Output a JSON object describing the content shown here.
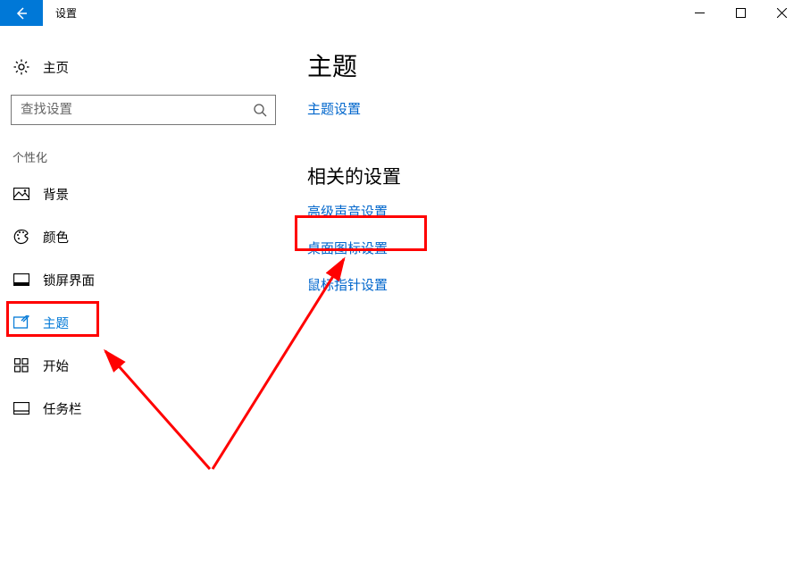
{
  "window": {
    "title": "设置"
  },
  "sidebar": {
    "home": "主页",
    "search_placeholder": "查找设置",
    "section": "个性化",
    "items": [
      {
        "label": "背景"
      },
      {
        "label": "颜色"
      },
      {
        "label": "锁屏界面"
      },
      {
        "label": "主题"
      },
      {
        "label": "开始"
      },
      {
        "label": "任务栏"
      }
    ]
  },
  "content": {
    "heading": "主题",
    "theme_settings_link": "主题设置",
    "related_heading": "相关的设置",
    "links": [
      "高级声音设置",
      "桌面图标设置",
      "鼠标指针设置"
    ]
  }
}
